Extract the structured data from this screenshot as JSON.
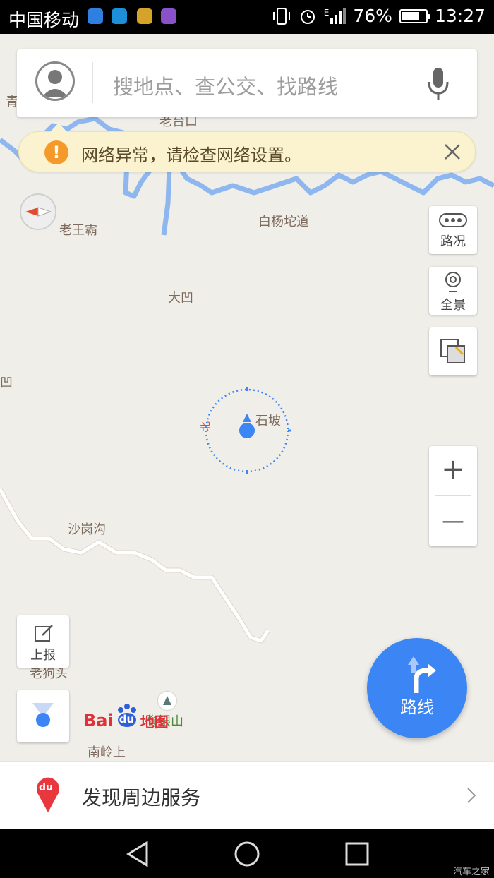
{
  "status_bar": {
    "carrier": "中国移动",
    "network": "E",
    "battery_percent": "76%",
    "battery_level": 0.76,
    "time": "13:27"
  },
  "search": {
    "placeholder": "搜地点、查公交、找路线",
    "avatar_icon": "user-avatar-icon",
    "voice_icon": "microphone-icon"
  },
  "alert": {
    "message": "网络异常，请检查网络设置。",
    "icon": "warning-icon",
    "color": "#f59a2a"
  },
  "map": {
    "places": [
      "老王霸",
      "白杨坨道",
      "大凹",
      "石坡",
      "沙岗沟",
      "隐银山",
      "南岭上",
      "凹",
      "青",
      "老台口",
      "老狗头"
    ],
    "compass_label": "北",
    "accent": "#3b85f5"
  },
  "controls": {
    "traffic": "路况",
    "panorama": "全景",
    "report": "上报",
    "zoom_in": "+",
    "zoom_out": "—"
  },
  "route_button": {
    "label": "路线"
  },
  "logo": {
    "text_bai": "Bai",
    "text_du": "du",
    "text_map": "地图"
  },
  "bottom_bar": {
    "label": "发现周边服务",
    "badge": "du"
  },
  "watermark": "汽车之家"
}
